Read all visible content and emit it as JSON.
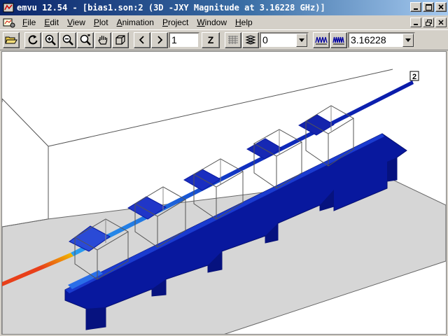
{
  "window": {
    "title": "emvu 12.54 - [bias1.son:2 (3D -JXY Magnitude at 3.16228 GHz)]",
    "controls": [
      "minimize",
      "maximize",
      "close"
    ]
  },
  "menu": {
    "items": [
      {
        "label": "File",
        "accel": "F"
      },
      {
        "label": "Edit",
        "accel": "E"
      },
      {
        "label": "View",
        "accel": "V"
      },
      {
        "label": "Plot",
        "accel": "P"
      },
      {
        "label": "Animation",
        "accel": "A"
      },
      {
        "label": "Project",
        "accel": "P"
      },
      {
        "label": "Window",
        "accel": "W"
      },
      {
        "label": "Help",
        "accel": "H"
      }
    ]
  },
  "toolbar": {
    "level_value": "1",
    "z_label": "Z",
    "layer_combo_value": "0",
    "frequency_combo_value": "3.16228"
  },
  "viewport": {
    "port_label": "2",
    "colors": {
      "board": "#d6d6d6",
      "metal_low": "#0a1aa8",
      "metal_mid": "#1f6ee0",
      "metal_high": "#e8401a"
    }
  }
}
